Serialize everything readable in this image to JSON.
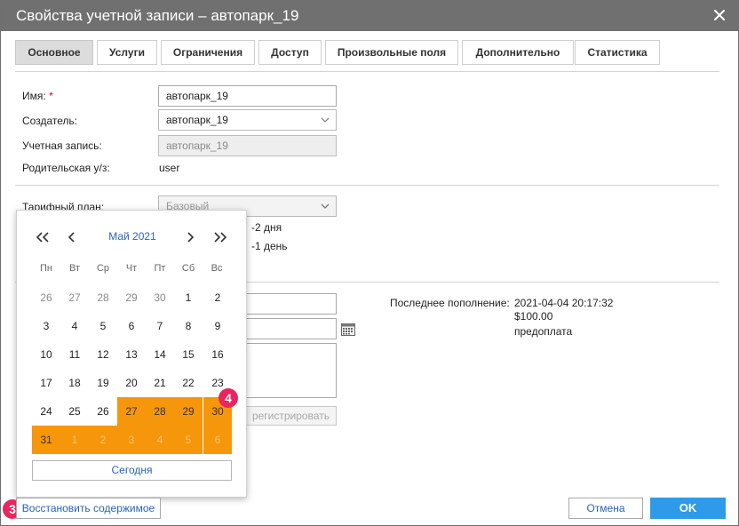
{
  "dialog": {
    "title": "Свойства учетной записи – автопарк_19"
  },
  "tabs": [
    {
      "label": "Основное",
      "active": true
    },
    {
      "label": "Услуги"
    },
    {
      "label": "Ограничения"
    },
    {
      "label": "Доступ"
    },
    {
      "label": "Произвольные поля"
    },
    {
      "label": "Дополнительно"
    },
    {
      "label": "Статистика"
    }
  ],
  "form": {
    "name_label": "Имя:",
    "required_mark": "*",
    "name_value": "автопарк_19",
    "creator_label": "Создатель:",
    "creator_value": "автопарк_19",
    "account_label": "Учетная запись:",
    "account_value": "автопарк_19",
    "parent_label": "Родительская у/з:",
    "parent_value": "user",
    "plan_label": "Тарифный план:",
    "plan_value": "Базовый",
    "days_remaining_1": "-2 дня",
    "days_remaining_2": "-1 день"
  },
  "last_topup": {
    "label": "Последнее пополнение:",
    "date": "2021-04-04 20:17:32",
    "amount": "$100.00",
    "type": "предоплата"
  },
  "register_button": "регистрировать",
  "calendar": {
    "month_label": "Май 2021",
    "weekdays": [
      "Пн",
      "Вт",
      "Ср",
      "Чт",
      "Пт",
      "Сб",
      "Вс"
    ],
    "rows": [
      [
        "26",
        "27",
        "28",
        "29",
        "30",
        "1",
        "2"
      ],
      [
        "3",
        "4",
        "5",
        "6",
        "7",
        "8",
        "9"
      ],
      [
        "10",
        "11",
        "12",
        "13",
        "14",
        "15",
        "16"
      ],
      [
        "17",
        "18",
        "19",
        "20",
        "21",
        "22",
        "23"
      ],
      [
        "24",
        "25",
        "26",
        "27",
        "28",
        "29",
        "30"
      ],
      [
        "31",
        "1",
        "2",
        "3",
        "4",
        "5",
        "6"
      ]
    ],
    "today_button": "Сегодня",
    "accent_color": "#f6960b"
  },
  "badges": {
    "three": "3",
    "four": "4"
  },
  "footer": {
    "restore": "Восстановить содержимое",
    "cancel": "Отмена",
    "ok": "OK"
  },
  "colors": {
    "titlebar": "#707070",
    "link": "#2a63b8",
    "primary": "#2f9be8",
    "badge": "#e8265e"
  }
}
